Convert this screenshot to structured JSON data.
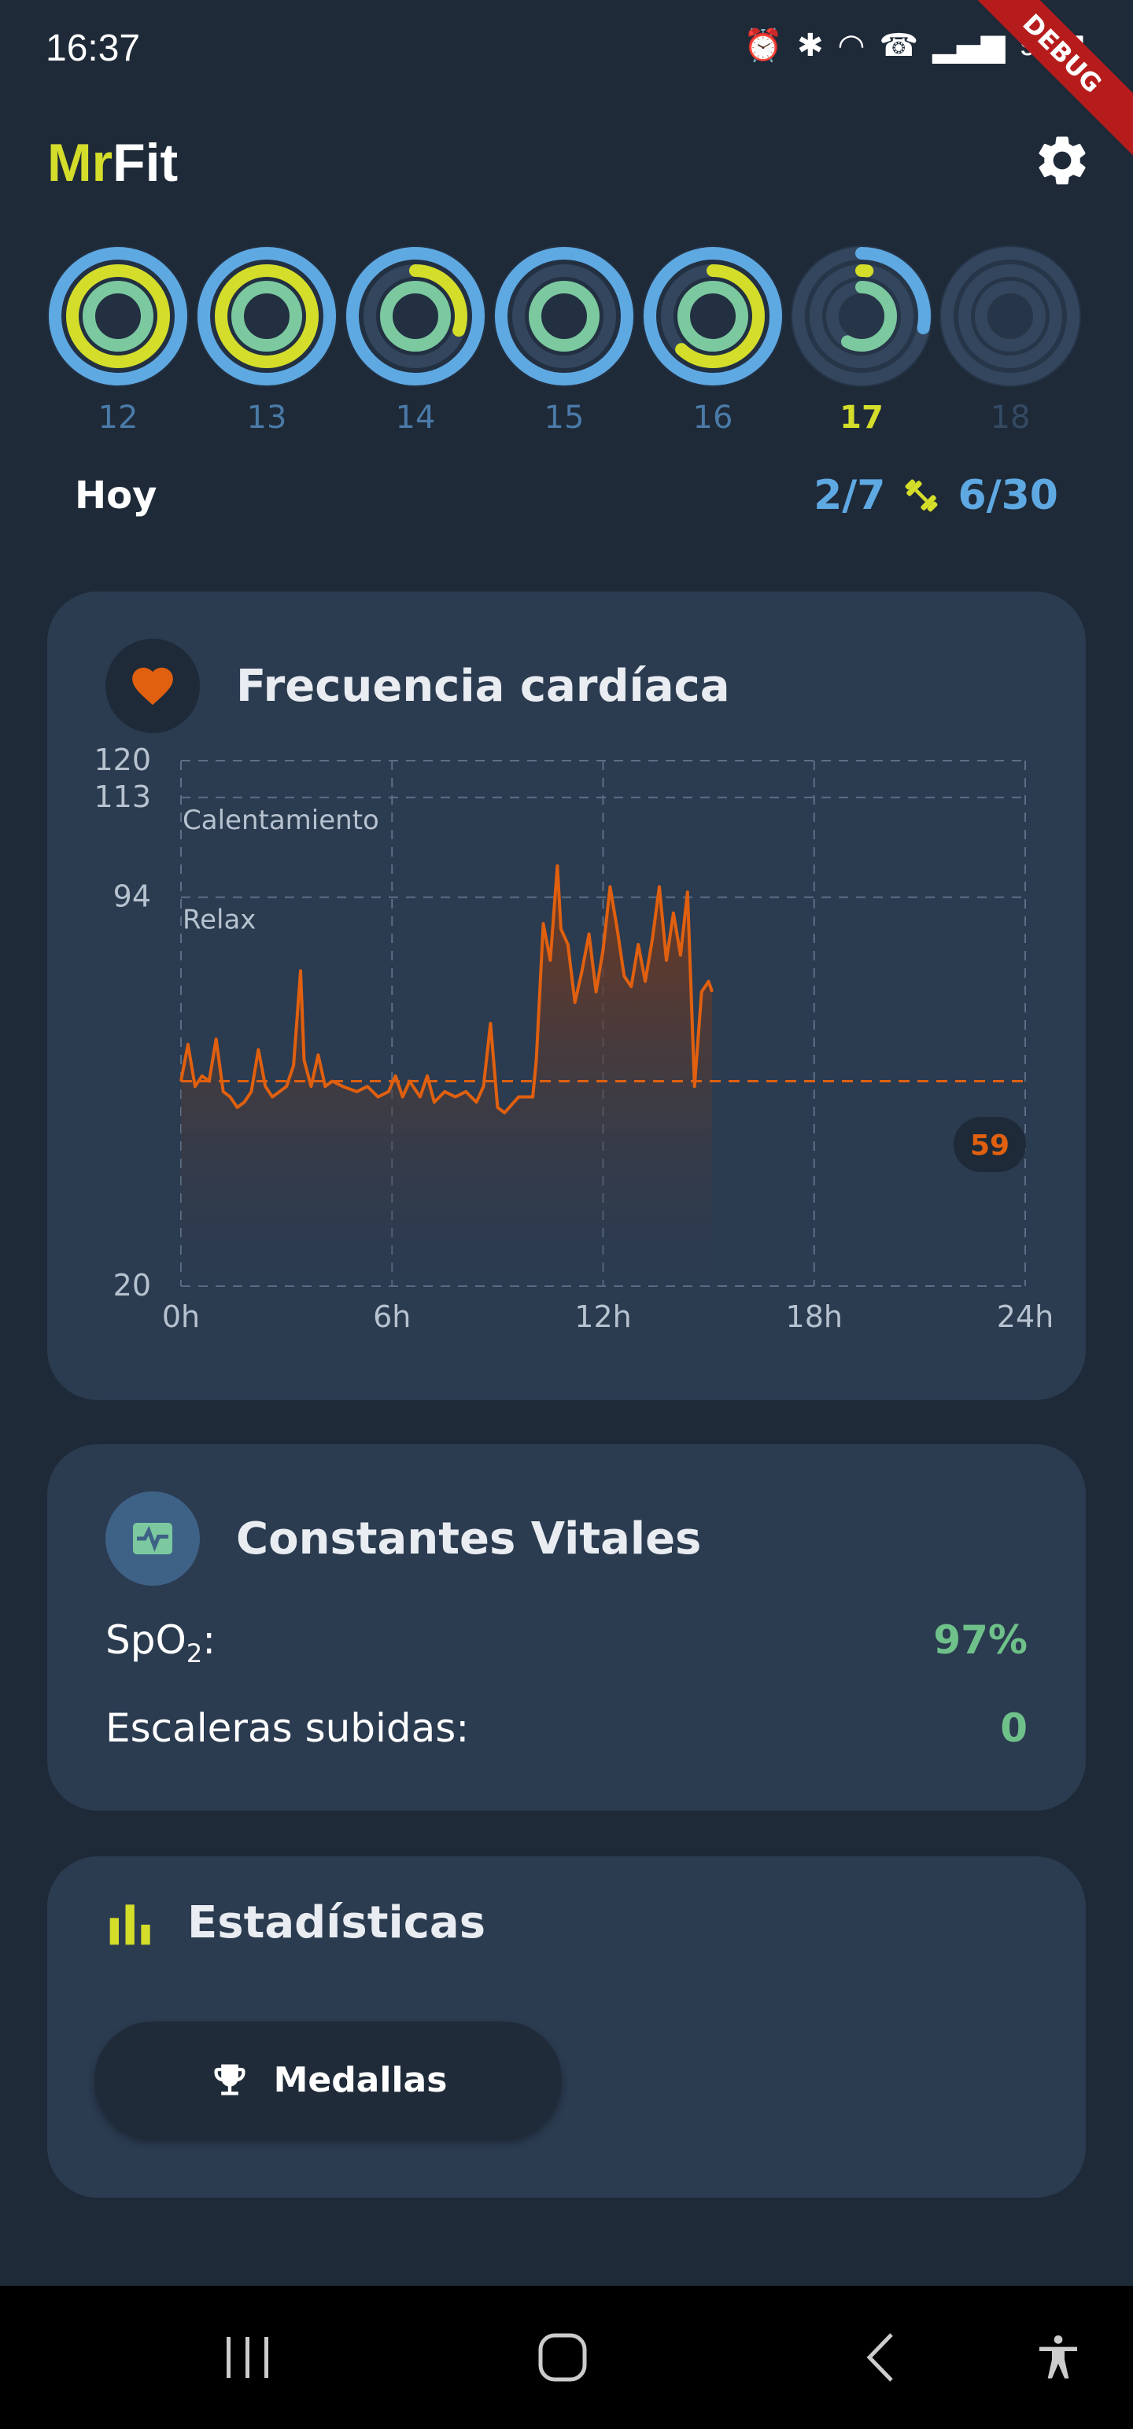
{
  "status_bar": {
    "time": "16:37",
    "battery": "99",
    "debug_banner": "DEBUG"
  },
  "header": {
    "brand_part1": "Mr",
    "brand_part2": "Fit",
    "settings_icon": "gear-icon"
  },
  "colors": {
    "background": "#1e2a38",
    "card": "#2b3b50",
    "accent_yellow": "#d4dd2a",
    "accent_blue": "#5fa9e3",
    "accent_green": "#7cc9a0",
    "heart_orange": "#e0600f"
  },
  "week": {
    "days": [
      {
        "label": "12",
        "outer": 1.0,
        "middle": 1.0,
        "inner": 1.0
      },
      {
        "label": "13",
        "outer": 1.0,
        "middle": 1.0,
        "inner": 1.0
      },
      {
        "label": "14",
        "outer": 1.0,
        "middle": 0.3,
        "inner": 1.0
      },
      {
        "label": "15",
        "outer": 1.0,
        "middle": 0.0,
        "inner": 1.0
      },
      {
        "label": "16",
        "outer": 1.0,
        "middle": 0.62,
        "inner": 1.0
      },
      {
        "label": "17",
        "outer": 0.28,
        "middle": 0.02,
        "inner": 0.58
      },
      {
        "label": "18",
        "outer": 0,
        "middle": 0,
        "inner": 0
      }
    ],
    "today_label": "Hoy",
    "goal_days": "2/7",
    "goal_total": "6/30"
  },
  "heart_rate": {
    "title": "Frecuencia cardíaca",
    "current_badge": "59",
    "zones": [
      {
        "label": "Calentamiento",
        "value": 113
      },
      {
        "label": "Relax",
        "value": 94
      }
    ]
  },
  "chart_data": {
    "type": "area",
    "title": "Frecuencia cardíaca",
    "xlabel": "",
    "ylabel": "",
    "ylim": [
      20,
      120
    ],
    "xlim": [
      0,
      24
    ],
    "x_ticks": [
      "0h",
      "6h",
      "12h",
      "18h",
      "24h"
    ],
    "y_ticks": [
      20,
      94,
      113,
      120
    ],
    "average_line": 59,
    "grid": true,
    "series": [
      {
        "values": [
          [
            0,
            59
          ],
          [
            0.2,
            66
          ],
          [
            0.4,
            58
          ],
          [
            0.6,
            60
          ],
          [
            0.8,
            59
          ],
          [
            1.0,
            67
          ],
          [
            1.2,
            57
          ],
          [
            1.4,
            56
          ],
          [
            1.6,
            54
          ],
          [
            1.8,
            55
          ],
          [
            2.0,
            57
          ],
          [
            2.2,
            65
          ],
          [
            2.4,
            58
          ],
          [
            2.6,
            56
          ],
          [
            2.8,
            57
          ],
          [
            3.0,
            58
          ],
          [
            3.2,
            62
          ],
          [
            3.4,
            80
          ],
          [
            3.5,
            63
          ],
          [
            3.7,
            58
          ],
          [
            3.9,
            64
          ],
          [
            4.1,
            58
          ],
          [
            4.3,
            59
          ],
          [
            4.6,
            58
          ],
          [
            5.0,
            57
          ],
          [
            5.3,
            58
          ],
          [
            5.6,
            56
          ],
          [
            5.9,
            57
          ],
          [
            6.1,
            60
          ],
          [
            6.3,
            56
          ],
          [
            6.5,
            59
          ],
          [
            6.8,
            56
          ],
          [
            7.0,
            60
          ],
          [
            7.2,
            55
          ],
          [
            7.5,
            57
          ],
          [
            7.8,
            56
          ],
          [
            8.1,
            57
          ],
          [
            8.4,
            55
          ],
          [
            8.6,
            58
          ],
          [
            8.8,
            70
          ],
          [
            9.0,
            54
          ],
          [
            9.2,
            53
          ],
          [
            9.6,
            56
          ],
          [
            10.0,
            56
          ],
          [
            10.1,
            63
          ],
          [
            10.3,
            89
          ],
          [
            10.5,
            82
          ],
          [
            10.7,
            100
          ],
          [
            10.8,
            88
          ],
          [
            11.0,
            85
          ],
          [
            11.2,
            74
          ],
          [
            11.4,
            80
          ],
          [
            11.6,
            87
          ],
          [
            11.8,
            76
          ],
          [
            12.0,
            84
          ],
          [
            12.2,
            96
          ],
          [
            12.4,
            88
          ],
          [
            12.6,
            79
          ],
          [
            12.8,
            77
          ],
          [
            13.0,
            85
          ],
          [
            13.2,
            78
          ],
          [
            13.4,
            86
          ],
          [
            13.6,
            96
          ],
          [
            13.8,
            82
          ],
          [
            14.0,
            91
          ],
          [
            14.2,
            83
          ],
          [
            14.4,
            95
          ],
          [
            14.6,
            58
          ],
          [
            14.8,
            76
          ],
          [
            15.0,
            78
          ],
          [
            15.1,
            76
          ]
        ]
      }
    ]
  },
  "vitals": {
    "title": "Constantes Vitales",
    "spo2_label_main": "SpO",
    "spo2_label_sub": "2",
    "spo2_label_colon": ":",
    "spo2_value": "97%",
    "stairs_label": "Escaleras subidas:",
    "stairs_value": "0"
  },
  "stats": {
    "title": "Estadísticas",
    "medals_label": "Medallas"
  }
}
